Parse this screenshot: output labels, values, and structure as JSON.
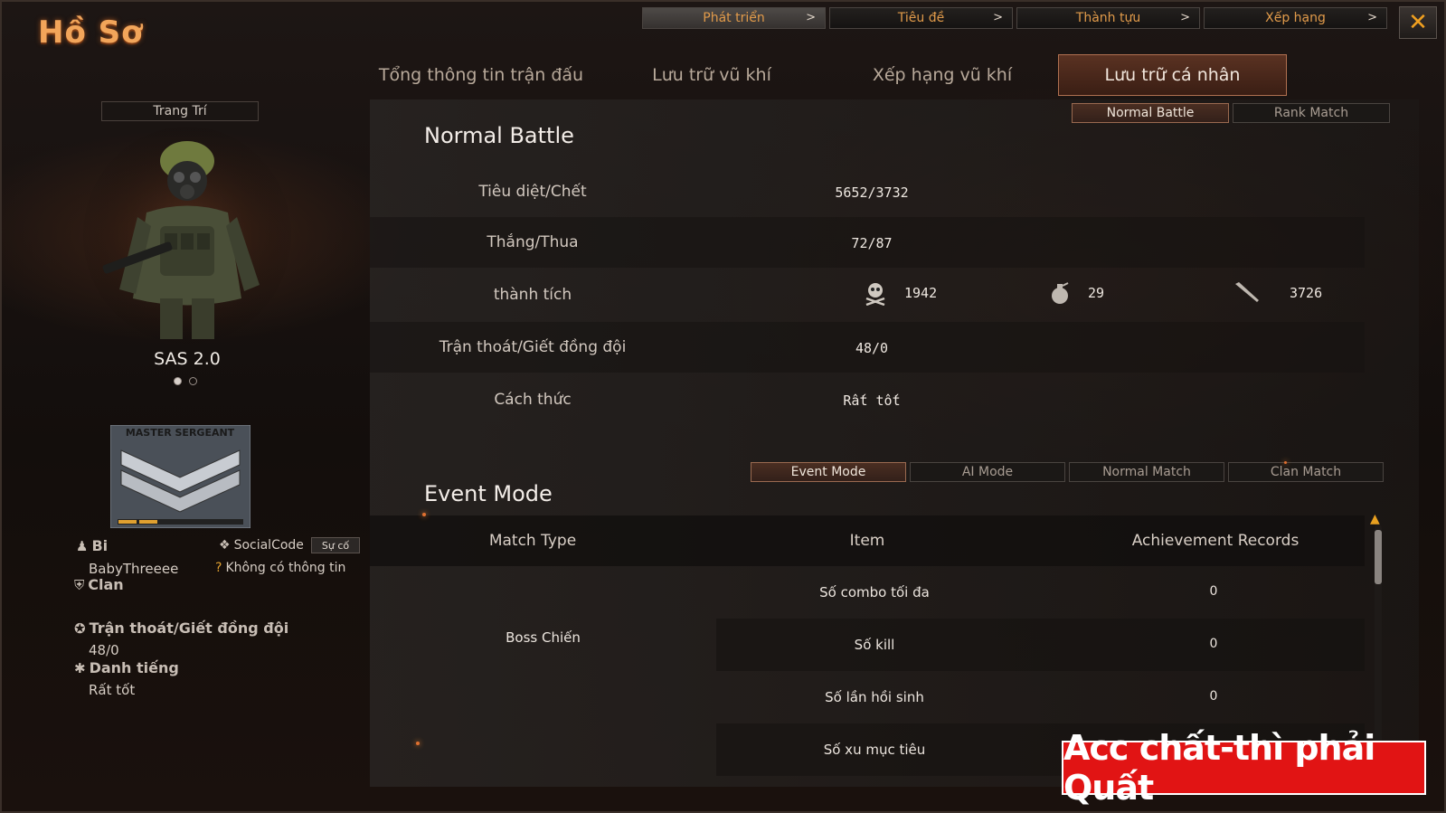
{
  "window": {
    "title": "Hồ Sơ",
    "close_label": "✕"
  },
  "top_nav": [
    {
      "label": "Phát triển",
      "active": true
    },
    {
      "label": "Tiêu đề",
      "active": false
    },
    {
      "label": "Thành tựu",
      "active": false
    },
    {
      "label": "Xếp hạng",
      "active": false
    }
  ],
  "tabs": [
    {
      "label": "Tổng thông tin trận đấu",
      "active": false
    },
    {
      "label": "Lưu trữ vũ khí",
      "active": false
    },
    {
      "label": "Xếp hạng vũ khí",
      "active": false
    },
    {
      "label": "Lưu trữ cá nhân",
      "active": true
    }
  ],
  "left": {
    "decor_button": "Trang Trí",
    "character_name": "SAS 2.0",
    "rank_badge_text": "MASTER SERGEANT",
    "user_label": "Bi",
    "username": "BabyThreeee",
    "socialcode_label": "SocialCode",
    "suco_button": "Sự cố",
    "no_info": "Không có thông tin",
    "clan_label": "Clan",
    "escape_label": "Trận thoát/Giết đồng đội",
    "escape_value": "48/0",
    "reputation_label": "Danh tiếng",
    "reputation_value": "Rất tốt"
  },
  "battle_tabs": [
    {
      "label": "Normal Battle",
      "active": true
    },
    {
      "label": "Rank Match",
      "active": false
    }
  ],
  "normal_battle": {
    "title": "Normal Battle",
    "rows": [
      {
        "label": "Tiêu diệt/Chết",
        "value": "5652/3732"
      },
      {
        "label": "Thắng/Thua",
        "value": "72/87"
      },
      {
        "label": "thành tích",
        "value": ""
      },
      {
        "label": "Trận thoát/Giết đồng đội",
        "value": "48/0"
      },
      {
        "label": "Cách thức",
        "value": "Rất tốt"
      }
    ],
    "achievements": [
      {
        "icon": "skull-icon",
        "value": "1942"
      },
      {
        "icon": "grenade-icon",
        "value": "29"
      },
      {
        "icon": "knife-icon",
        "value": "3726"
      }
    ]
  },
  "mode_tabs": [
    {
      "label": "Event Mode",
      "active": true
    },
    {
      "label": "AI Mode",
      "active": false
    },
    {
      "label": "Normal Match",
      "active": false
    },
    {
      "label": "Clan Match",
      "active": false
    }
  ],
  "event_mode": {
    "title": "Event Mode",
    "headers": [
      "Match Type",
      "Item",
      "Achievement Records"
    ],
    "match_type": "Boss Chiến",
    "rows": [
      {
        "item": "Số combo tối đa",
        "value": "0"
      },
      {
        "item": "Số kill",
        "value": "0"
      },
      {
        "item": "Số lần hồi sinh",
        "value": "0"
      },
      {
        "item": "Số xu mục tiêu",
        "value": ""
      }
    ]
  },
  "banner": {
    "text": "Acc chất-thì phải Quất"
  },
  "colors": {
    "accent": "#f2a55a",
    "active_tab": "#5a3222",
    "banner": "#e11414"
  }
}
